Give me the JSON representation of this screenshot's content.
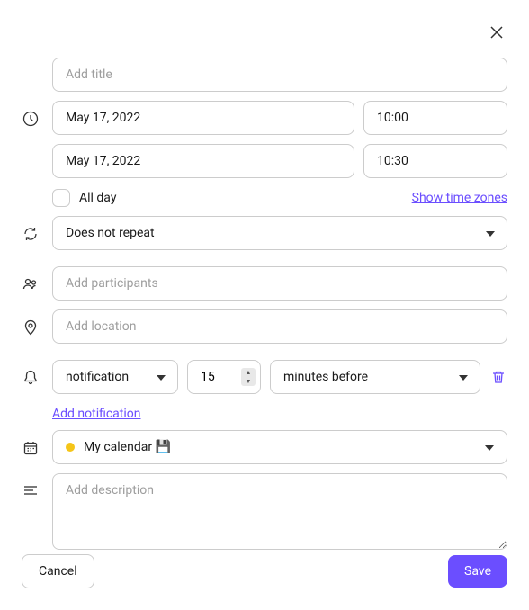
{
  "title": {
    "placeholder": "Add title",
    "value": ""
  },
  "datetime": {
    "start_date": "May 17, 2022",
    "start_time": "10:00",
    "end_date": "May 17, 2022",
    "end_time": "10:30",
    "all_day_label": "All day",
    "all_day_checked": false,
    "show_time_zones_label": "Show time zones"
  },
  "repeat": {
    "selected": "Does not repeat"
  },
  "participants": {
    "placeholder": "Add participants",
    "value": ""
  },
  "location": {
    "placeholder": "Add location",
    "value": ""
  },
  "notification": {
    "type": "notification",
    "number": "15",
    "unit": "minutes before",
    "add_label": "Add notification"
  },
  "calendar": {
    "dot_color": "#f5c518",
    "label": "My calendar 💾"
  },
  "description": {
    "placeholder": "Add description",
    "value": ""
  },
  "footer": {
    "cancel": "Cancel",
    "save": "Save"
  }
}
